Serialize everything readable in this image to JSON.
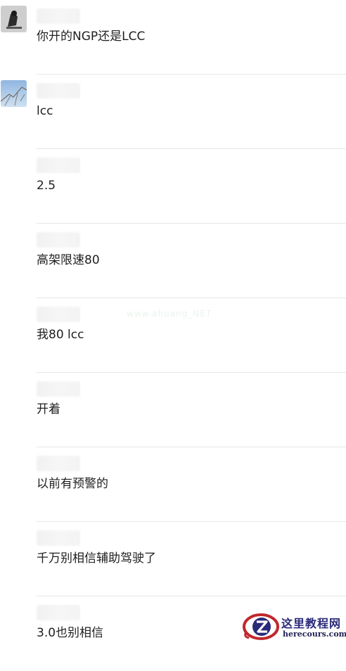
{
  "messages": [
    {
      "text": "你开的NGP还是LCC",
      "avatar": "photo-dark"
    },
    {
      "text": "lcc",
      "avatar": "photo-sky"
    },
    {
      "text": "2.5",
      "avatar": "none"
    },
    {
      "text": "高架限速80",
      "avatar": "none"
    },
    {
      "text": "我80 lcc",
      "avatar": "none"
    },
    {
      "text": "开着",
      "avatar": "none"
    },
    {
      "text": "以前有预警的",
      "avatar": "none"
    },
    {
      "text": "千万别相信辅助驾驶了",
      "avatar": "none"
    },
    {
      "text": "3.0也别相信",
      "avatar": "none"
    }
  ],
  "watermark": {
    "text": "www.ahuang_NET"
  },
  "site_logo": {
    "cn_text": "这里教程网",
    "url_text": "herecours.com",
    "colors": {
      "red": "#c0282d",
      "blue": "#2a2a7a"
    }
  }
}
